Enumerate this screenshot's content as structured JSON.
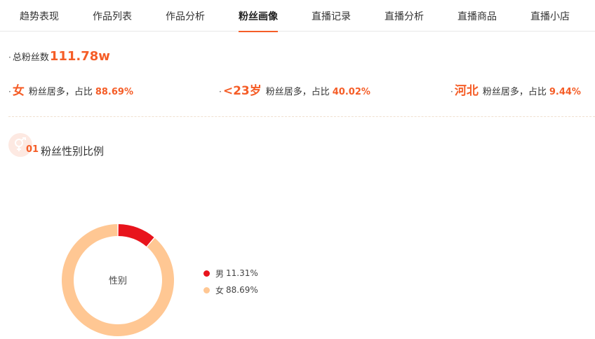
{
  "tabs": [
    {
      "label": "趋势表现",
      "active": false
    },
    {
      "label": "作品列表",
      "active": false
    },
    {
      "label": "作品分析",
      "active": false
    },
    {
      "label": "粉丝画像",
      "active": true
    },
    {
      "label": "直播记录",
      "active": false
    },
    {
      "label": "直播分析",
      "active": false
    },
    {
      "label": "直播商品",
      "active": false
    },
    {
      "label": "直播小店",
      "active": false
    }
  ],
  "summary": {
    "total_label": "总粉丝数",
    "total_value": "111.78w",
    "gender": {
      "key": "女",
      "text": "粉丝居多，占比",
      "pct": "88.69%"
    },
    "age": {
      "key": "<23岁",
      "text": "粉丝居多，占比",
      "pct": "40.02%"
    },
    "region": {
      "key": "河北",
      "text": "粉丝居多，占比",
      "pct": "9.44%"
    }
  },
  "section": {
    "number": "01",
    "title": "粉丝性别比例",
    "icon": "gender-icon"
  },
  "chart_data": {
    "type": "pie",
    "center_label": "性别",
    "categories": [
      "男",
      "女"
    ],
    "values": [
      11.31,
      88.69
    ],
    "value_labels": [
      "11.31%",
      "88.69%"
    ],
    "colors": [
      "#e8141c",
      "#ffc793"
    ],
    "legend_position": "right"
  },
  "colors": {
    "accent": "#f55d27"
  }
}
